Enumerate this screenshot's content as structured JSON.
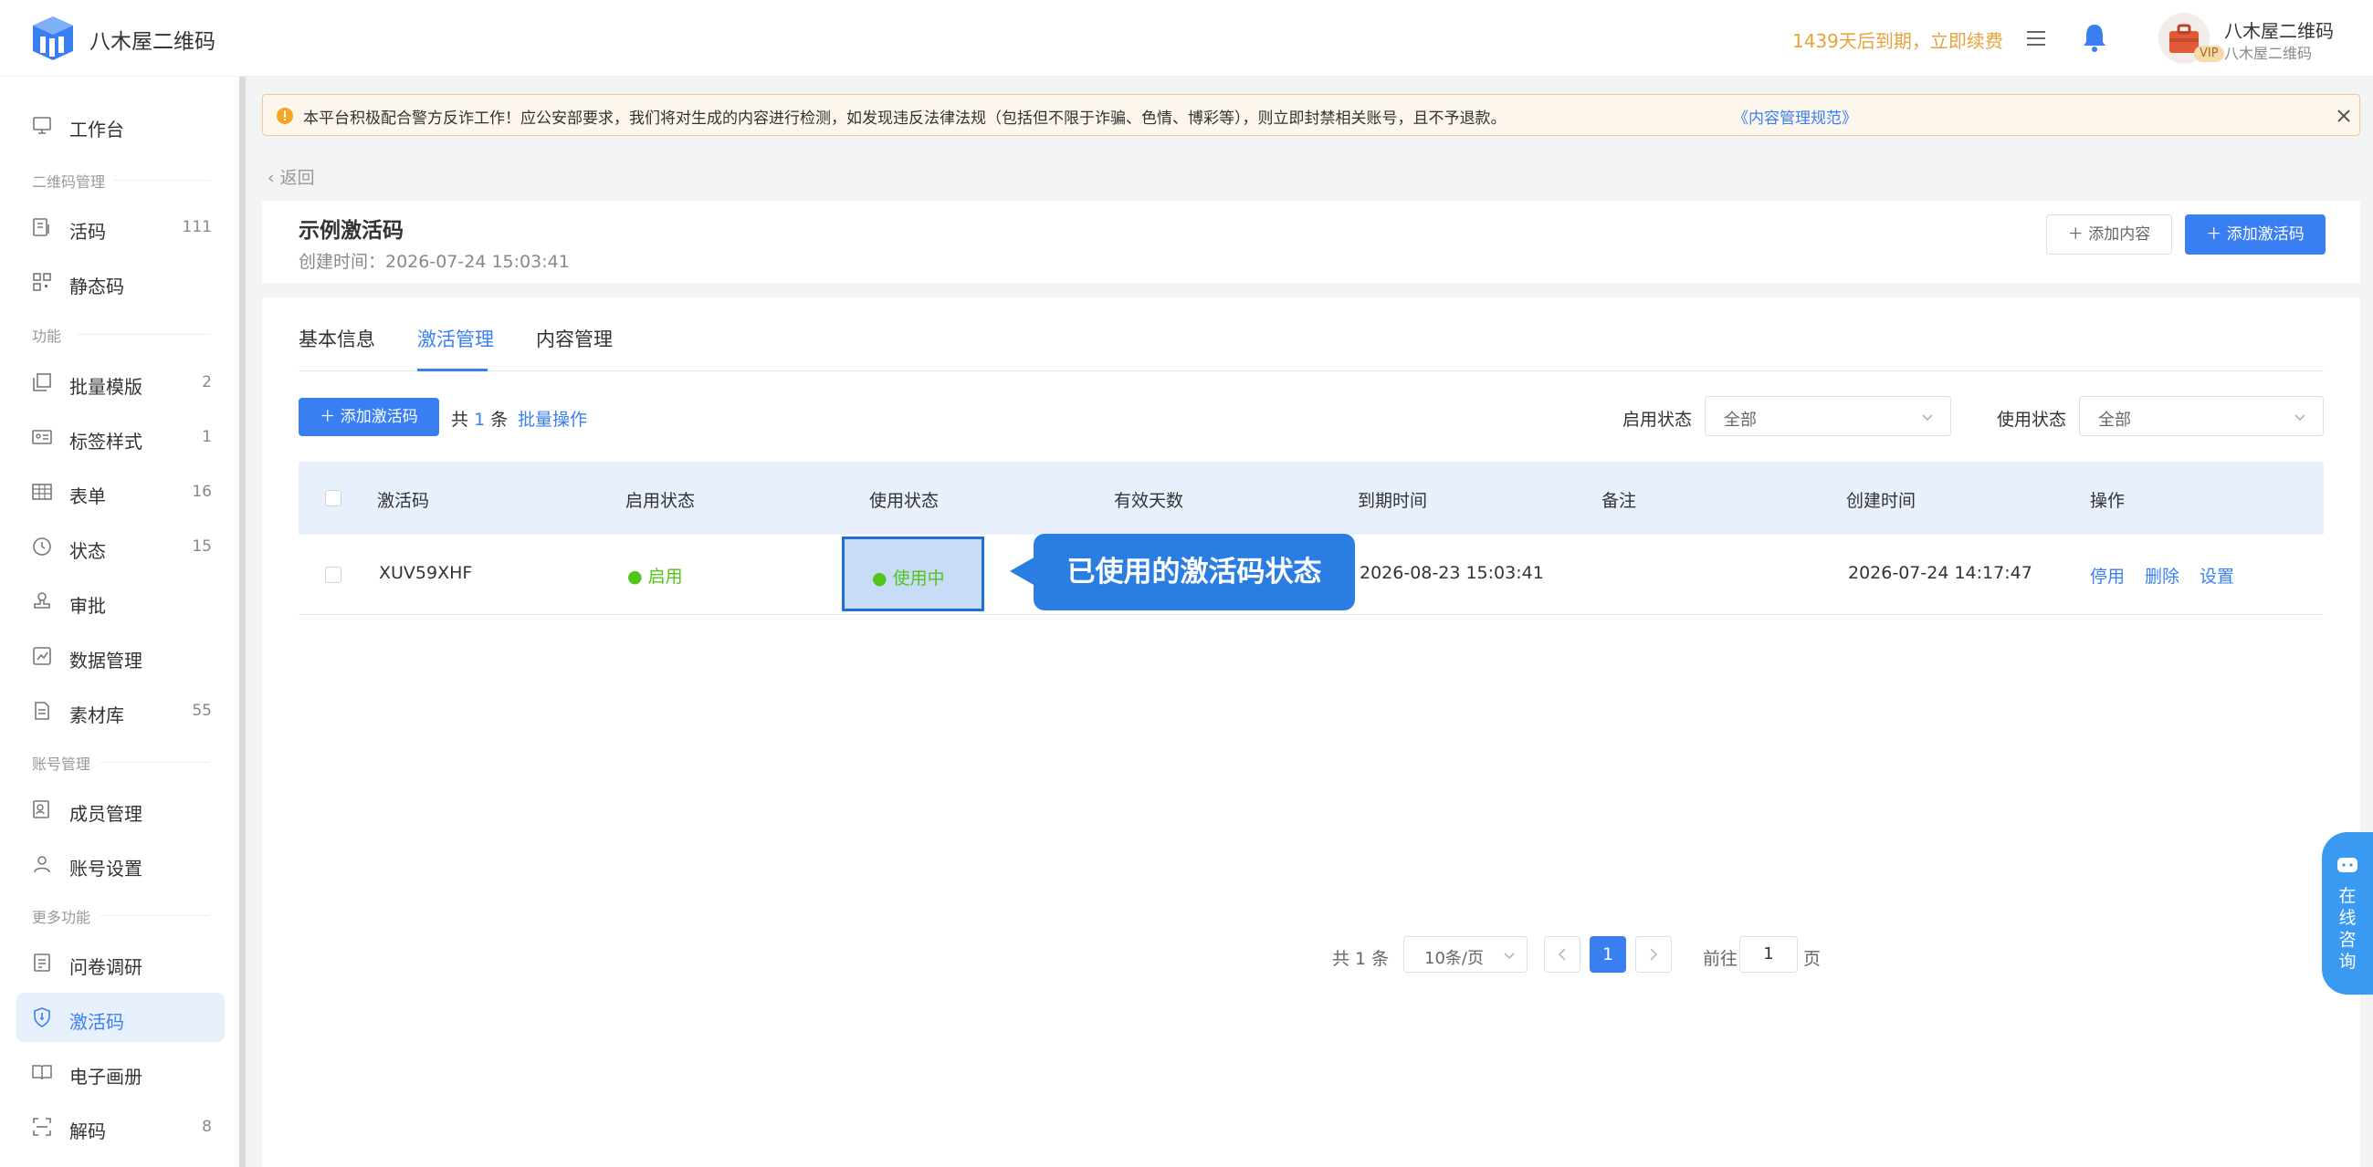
{
  "header": {
    "app_name": "八木屋二维码",
    "expire_text": "1439天后到期，立即续费",
    "user_name": "八木屋二维码",
    "user_sub": "八木屋二维码",
    "vip_label": "VIP"
  },
  "sidebar": {
    "workbench": "工作台",
    "sections": {
      "qr_manage": "二维码管理",
      "features": "功能",
      "account": "账号管理",
      "more": "更多功能"
    },
    "items": [
      {
        "label": "活码",
        "count": "111"
      },
      {
        "label": "静态码",
        "count": ""
      },
      {
        "label": "批量模版",
        "count": "2"
      },
      {
        "label": "标签样式",
        "count": "1"
      },
      {
        "label": "表单",
        "count": "16"
      },
      {
        "label": "状态",
        "count": "15"
      },
      {
        "label": "审批",
        "count": ""
      },
      {
        "label": "数据管理",
        "count": ""
      },
      {
        "label": "素材库",
        "count": "55"
      },
      {
        "label": "成员管理",
        "count": ""
      },
      {
        "label": "账号设置",
        "count": ""
      },
      {
        "label": "问卷调研",
        "count": ""
      },
      {
        "label": "激活码",
        "count": ""
      },
      {
        "label": "电子画册",
        "count": ""
      },
      {
        "label": "解码",
        "count": "8"
      }
    ]
  },
  "notice": {
    "text": "本平台积极配合警方反诈工作！应公安部要求，我们将对生成的内容进行检测，如发现违反法律法规（包括但不限于诈骗、色情、博彩等），则立即封禁相关账号，且不予退款。",
    "link": "《内容管理规范》"
  },
  "back_label": "返回",
  "code": {
    "title": "示例激活码",
    "created": "创建时间：2026-07-24 15:03:41",
    "add_content": "添加内容",
    "add_code": "添加激活码"
  },
  "tabs": [
    "基本信息",
    "激活管理",
    "内容管理"
  ],
  "toolbar": {
    "add_code": "添加激活码",
    "total_prefix": "共",
    "total_num": "1",
    "total_suffix": "条",
    "batch": "批量操作",
    "enable_label": "启用状态",
    "enable_value": "全部",
    "use_label": "使用状态",
    "use_value": "全部"
  },
  "table": {
    "headers": [
      "激活码",
      "启用状态",
      "使用状态",
      "有效天数",
      "到期时间",
      "备注",
      "创建时间",
      "操作"
    ],
    "rows": [
      {
        "code": "XUV59XHF",
        "enable": "● 启用",
        "use": "● 使用中",
        "days": "",
        "expire": "2026-08-23 15:03:41",
        "remark": "",
        "created": "2026-07-24 14:17:47",
        "ops": [
          "停用",
          "删除",
          "设置"
        ]
      }
    ]
  },
  "callout": "已使用的激活码状态",
  "pager": {
    "total": "共 1 条",
    "size": "10条/页",
    "current": "1",
    "goto": "前往",
    "input": "1",
    "page": "页"
  },
  "consult": "在线咨询",
  "colors": {
    "primary": "#3a7ff2",
    "success": "#52c41a",
    "warning": "#e6a23c",
    "callout": "#2a7de1"
  }
}
